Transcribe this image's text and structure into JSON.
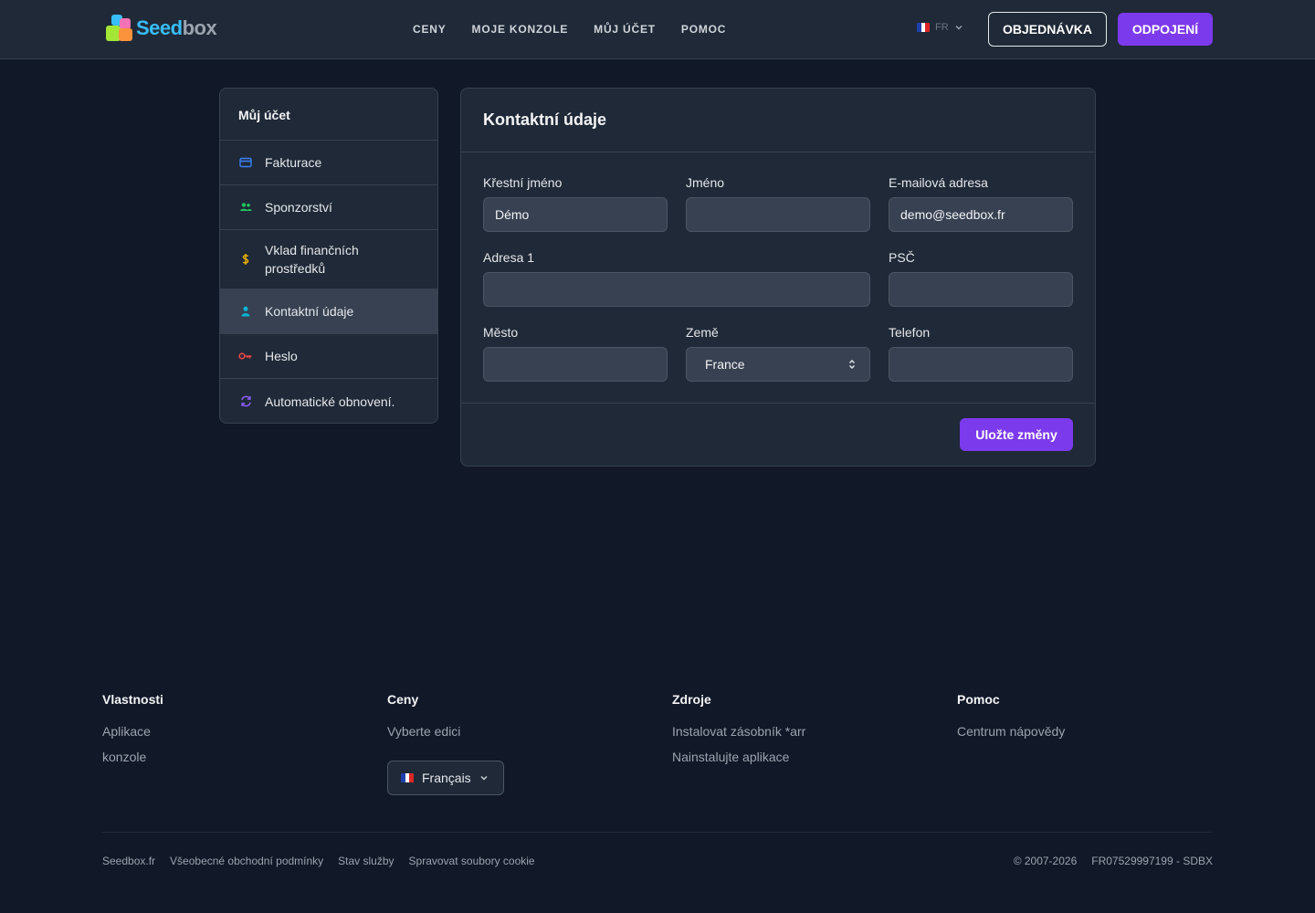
{
  "header": {
    "logo_text_a": "Seed",
    "logo_text_b": "box",
    "nav": [
      "CENY",
      "MOJE KONZOLE",
      "MŮJ ÚČET",
      "POMOC"
    ],
    "lang_code": "FR",
    "order_label": "OBJEDNÁVKA",
    "logout_label": "ODPOJENÍ"
  },
  "sidebar": {
    "title": "Můj účet",
    "items": [
      {
        "label": "Fakturace",
        "icon": "credit-card-icon",
        "color": "#3b82f6"
      },
      {
        "label": "Sponzorství",
        "icon": "users-icon",
        "color": "#22c55e"
      },
      {
        "label": "Vklad finančních prostředků",
        "icon": "dollar-icon",
        "color": "#eab308"
      },
      {
        "label": "Kontaktní údaje",
        "icon": "user-icon",
        "color": "#06b6d4"
      },
      {
        "label": "Heslo",
        "icon": "key-icon",
        "color": "#ef4444"
      },
      {
        "label": "Automatické obnovení.",
        "icon": "refresh-icon",
        "color": "#8b5cf6"
      }
    ]
  },
  "form": {
    "title": "Kontaktní údaje",
    "first_name_label": "Křestní jméno",
    "first_name_value": "Démo",
    "last_name_label": "Jméno",
    "last_name_value": "",
    "email_label": "E-mailová adresa",
    "email_value": "demo@seedbox.fr",
    "address_label": "Adresa 1",
    "address_value": "",
    "zip_label": "PSČ",
    "zip_value": "",
    "city_label": "Město",
    "city_value": "",
    "country_label": "Země",
    "country_value": "France",
    "phone_label": "Telefon",
    "phone_value": "",
    "save_label": "Uložte změny"
  },
  "footer": {
    "col1": {
      "title": "Vlastnosti",
      "links": [
        "Aplikace",
        "konzole"
      ]
    },
    "col2": {
      "title": "Ceny",
      "links": [
        "Vyberte edici"
      ]
    },
    "col3": {
      "title": "Zdroje",
      "links": [
        "Instalovat zásobník *arr",
        "Nainstalujte aplikace"
      ]
    },
    "col4": {
      "title": "Pomoc",
      "links": [
        "Centrum nápovědy"
      ]
    },
    "language": "Français",
    "bottom_links": [
      "Seedbox.fr",
      "Všeobecné obchodní podmínky",
      "Stav služby",
      "Spravovat soubory cookie"
    ],
    "copyright": "© 2007-2026",
    "company_id": "FR07529997199 - SDBX"
  },
  "colors": {
    "accent": "#7c3aed",
    "background": "#111827",
    "panel": "#1f2937"
  }
}
